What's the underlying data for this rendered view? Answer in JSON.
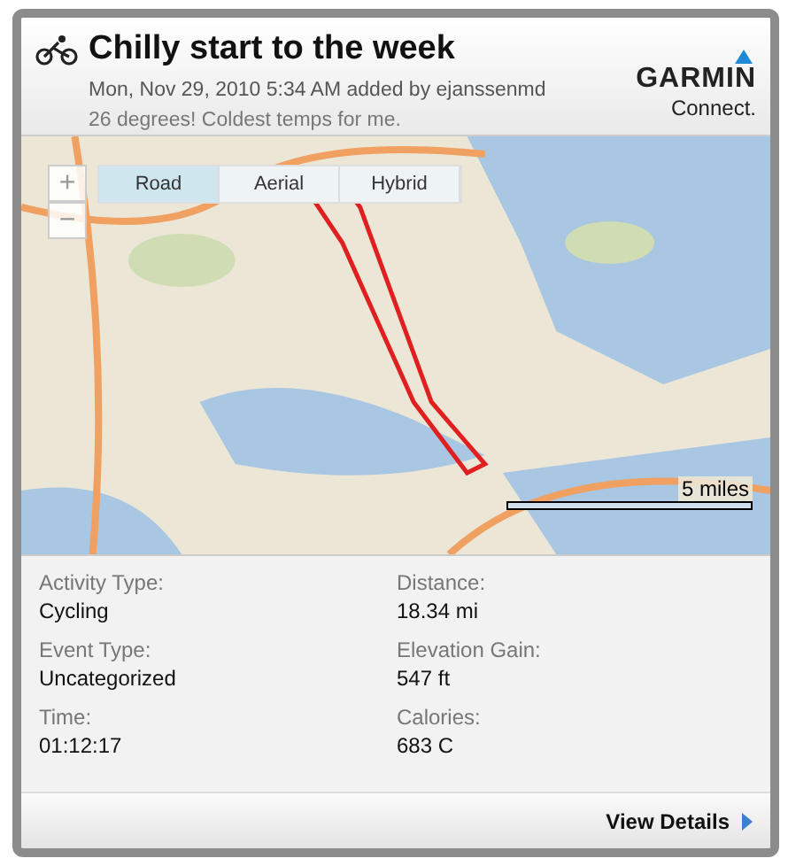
{
  "activity": {
    "title": "Chilly start to the week",
    "meta": "Mon, Nov 29, 2010 5:34 AM added by ejanssenmd",
    "note": "26 degrees! Coldest temps for me."
  },
  "logo": {
    "brand": "GARMIN",
    "product": "Connect."
  },
  "map": {
    "zoom_in": "+",
    "zoom_out": "−",
    "tabs": [
      {
        "label": "Road",
        "selected": true
      },
      {
        "label": "Aerial",
        "selected": false
      },
      {
        "label": "Hybrid",
        "selected": false
      }
    ],
    "scale": "5 miles"
  },
  "stats": [
    {
      "label": "Activity Type:",
      "value": "Cycling"
    },
    {
      "label": "Distance:",
      "value": "18.34 mi"
    },
    {
      "label": "Event Type:",
      "value": "Uncategorized"
    },
    {
      "label": "Elevation Gain:",
      "value": "547 ft"
    },
    {
      "label": "Time:",
      "value": "01:12:17"
    },
    {
      "label": "Calories:",
      "value": "683 C"
    }
  ],
  "footer": {
    "link": "View Details"
  }
}
